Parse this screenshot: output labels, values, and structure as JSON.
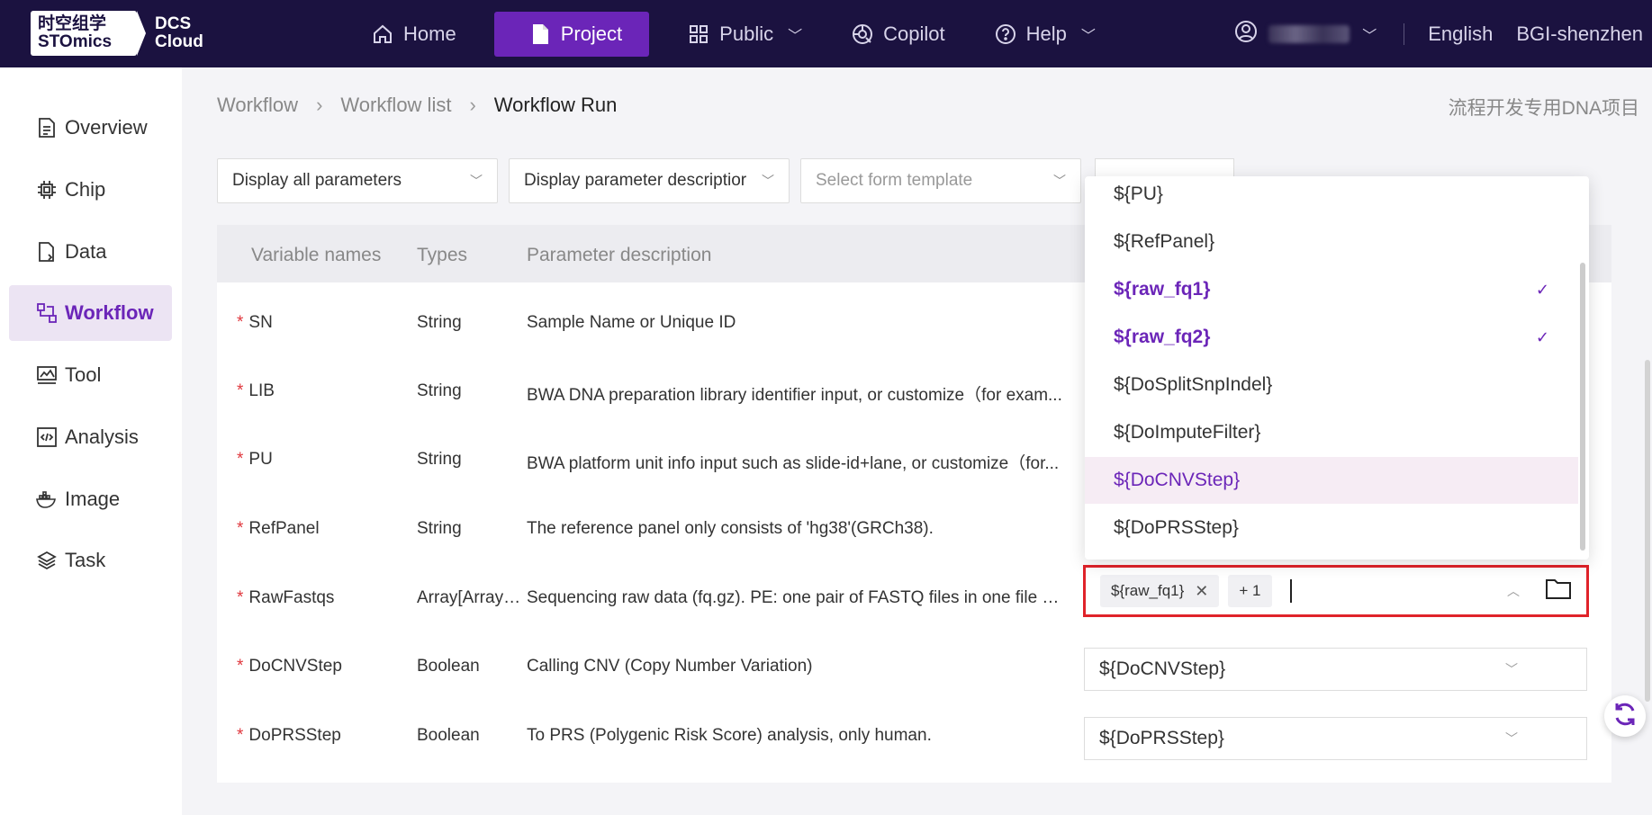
{
  "logo": {
    "cn_line1": "时空组学",
    "cn_line2": "STOmics",
    "dcs_line1": "DCS",
    "dcs_line2": "Cloud"
  },
  "nav": {
    "items": [
      {
        "label": "Home",
        "icon": "home-icon"
      },
      {
        "label": "Project",
        "icon": "document-icon"
      },
      {
        "label": "Public",
        "icon": "grid-icon"
      },
      {
        "label": "Copilot",
        "icon": "copilot-icon"
      },
      {
        "label": "Help",
        "icon": "help-icon"
      }
    ],
    "language": "English",
    "org": "BGI-shenzhen"
  },
  "sidebar": {
    "items": [
      {
        "label": "Overview",
        "icon": "document-icon"
      },
      {
        "label": "Chip",
        "icon": "chip-icon"
      },
      {
        "label": "Data",
        "icon": "data-icon"
      },
      {
        "label": "Workflow",
        "icon": "workflow-icon"
      },
      {
        "label": "Tool",
        "icon": "tool-icon"
      },
      {
        "label": "Analysis",
        "icon": "code-icon"
      },
      {
        "label": "Image",
        "icon": "docker-icon"
      },
      {
        "label": "Task",
        "icon": "layers-icon"
      }
    ]
  },
  "breadcrumb": {
    "items": [
      "Workflow",
      "Workflow list",
      "Workflow Run"
    ]
  },
  "project_name": "流程开发专用DNA项目",
  "filters": {
    "display_params": "Display all parameters",
    "display_desc": "Display parameter descriptior",
    "form_template_placeholder": "Select form template"
  },
  "table": {
    "headers": [
      "Variable names",
      "Types",
      "Parameter description"
    ],
    "rows": [
      {
        "name": "SN",
        "type": "String",
        "desc": "Sample Name or Unique ID"
      },
      {
        "name": "LIB",
        "type": "String",
        "desc": "BWA DNA preparation library identifier input, or customize（for exam..."
      },
      {
        "name": "PU",
        "type": "String",
        "desc": "BWA platform unit info input such as slide-id+lane, or customize（for..."
      },
      {
        "name": "RefPanel",
        "type": "String",
        "desc": "The reference panel only consists of 'hg38'(GRCh38)."
      },
      {
        "name": "RawFastqs",
        "type": "Array[Array[F...",
        "desc": "Sequencing raw data (fq.gz). PE: one pair of FASTQ files in one file gr..."
      },
      {
        "name": "DoCNVStep",
        "type": "Boolean",
        "desc": "Calling CNV (Copy Number Variation)",
        "value": "${DoCNVStep}"
      },
      {
        "name": "DoPRSStep",
        "type": "Boolean",
        "desc": "To PRS (Polygenic Risk Score) analysis, only human.",
        "value": "${DoPRSStep}"
      }
    ],
    "rawfastqs_tag": "${raw_fq1}",
    "rawfastqs_more": "+ 1"
  },
  "dropdown": {
    "options": [
      {
        "label": "${PU}",
        "selected": false
      },
      {
        "label": "${RefPanel}",
        "selected": false
      },
      {
        "label": "${raw_fq1}",
        "selected": true
      },
      {
        "label": "${raw_fq2}",
        "selected": true
      },
      {
        "label": "${DoSplitSnpIndel}",
        "selected": false
      },
      {
        "label": "${DoImputeFilter}",
        "selected": false
      },
      {
        "label": "${DoCNVStep}",
        "selected": false,
        "hover": true
      },
      {
        "label": "${DoPRSStep}",
        "selected": false
      }
    ]
  },
  "colors": {
    "accent": "#6b25b8",
    "topbar": "#1b1240",
    "required": "#e0383e",
    "focus_border": "#e0232a"
  }
}
